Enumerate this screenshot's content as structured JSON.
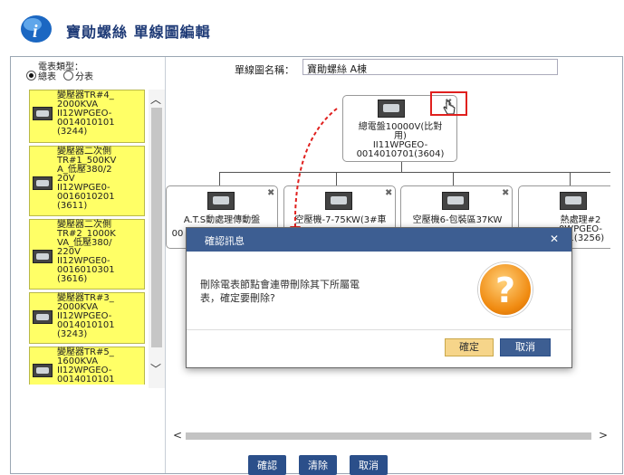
{
  "app": {
    "title": "寶勛螺絲 單線圖編輯"
  },
  "filter": {
    "label": "電表類型：",
    "options": [
      {
        "label": "總表",
        "selected": true
      },
      {
        "label": "分表",
        "selected": false
      }
    ]
  },
  "diagram": {
    "name_label": "單線圖名稱：",
    "name_value": "寶勛螺絲 A棟"
  },
  "meter_list": [
    {
      "text": "變壓器TR#4_\n2000KVA\nII12WPGEO-\n0014010101\n(3244)"
    },
    {
      "text": "變壓器二次側\nTR#1_500KV\nA_低壓380/2\n20V\nII12WPGE0-\n0016010201\n(3611)"
    },
    {
      "text": "變壓器二次側\nTR#2_1000K\nVA_低壓380/\n220V\nII12WPGE0-\n0016010301\n(3616)"
    },
    {
      "text": "變壓器TR#3_\n2000KVA\nII12WPGEO-\n0014010101\n(3243)"
    },
    {
      "text": "變壓器TR#5_\n1600KVA\nII12WPGEO-\n0014010101"
    }
  ],
  "nodes": {
    "root": {
      "label": "總電盤10000V(比對\n用)\nII11WPGEO-\n0014010701(3604)"
    },
    "c1": {
      "label": "A.T.S動處理傳動盤"
    },
    "c2": {
      "label": "空壓機-7-75KW(3#車"
    },
    "c3": {
      "label": "空壓機6-包裝區37KW"
    },
    "c4": {
      "label": "熱處理#2\n0WPGEO-\n101(3256)"
    },
    "c1b": {
      "label": "00"
    }
  },
  "modal": {
    "title": "確認訊息",
    "message": "刪除電表節點會連帶刪除其下所屬電\n表，確定要刪除?",
    "ok": "確定",
    "cancel": "取消"
  },
  "buttons": {
    "confirm": "確認",
    "clear": "清除",
    "cancel": "取消"
  },
  "colors": {
    "accent": "#2b4f8a",
    "meter_item": "#ffff66",
    "highlight": "#e0201e"
  }
}
